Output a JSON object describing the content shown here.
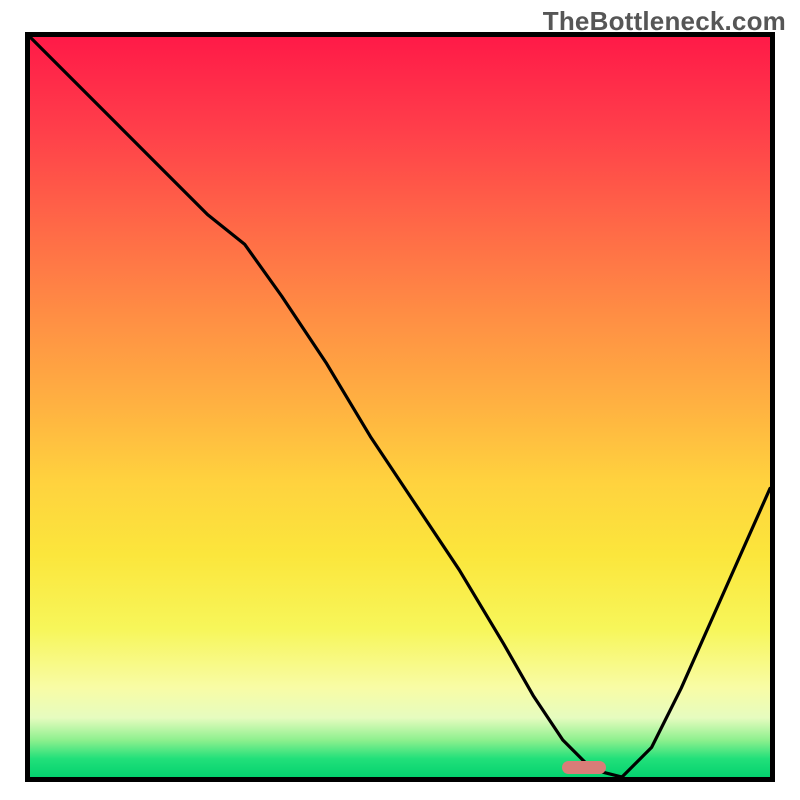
{
  "watermark": "TheBottleneck.com",
  "chart_data": {
    "type": "line",
    "title": "",
    "xlabel": "",
    "ylabel": "",
    "xlim": [
      0,
      100
    ],
    "ylim": [
      0,
      100
    ],
    "grid": false,
    "legend": false,
    "background_gradient": {
      "direction": "vertical",
      "stops": [
        {
          "pos": 0,
          "color": "#ff1a48"
        },
        {
          "pos": 26,
          "color": "#ff6a47"
        },
        {
          "pos": 50,
          "color": "#ffb241"
        },
        {
          "pos": 70,
          "color": "#fbe63c"
        },
        {
          "pos": 88,
          "color": "#f8fca6"
        },
        {
          "pos": 95,
          "color": "#8ef08e"
        },
        {
          "pos": 100,
          "color": "#04d26f"
        }
      ]
    },
    "series": [
      {
        "name": "bottleneck-curve",
        "x": [
          0,
          6,
          12,
          18,
          24,
          29,
          34,
          40,
          46,
          52,
          58,
          64,
          68,
          72,
          76,
          80,
          84,
          88,
          92,
          96,
          100
        ],
        "y": [
          100,
          94,
          88,
          82,
          76,
          72,
          65,
          56,
          46,
          37,
          28,
          18,
          11,
          5,
          1,
          0,
          4,
          12,
          21,
          30,
          39
        ]
      }
    ],
    "marker": {
      "shape": "rounded-bar",
      "approx_x_range": [
        72,
        78
      ],
      "approx_y": 1,
      "color": "#d97d78"
    }
  }
}
